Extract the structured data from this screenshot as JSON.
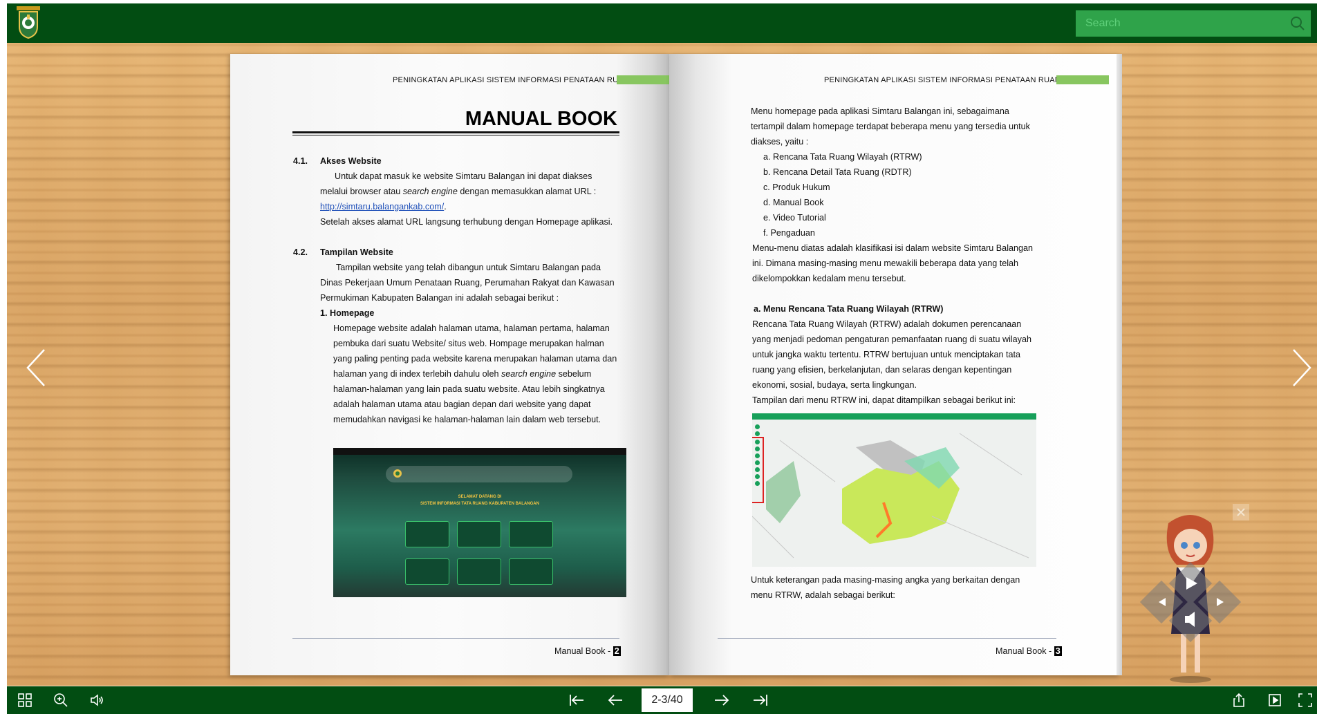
{
  "search": {
    "placeholder": "Search"
  },
  "left_page": {
    "header": "PENINGKATAN APLIKASI SISTEM INFORMASI PENATAAN RUANG",
    "title": "MANUAL BOOK",
    "section1_num": "4.1.",
    "section1_title": "Akses Website",
    "s1_line1": "Untuk dapat masuk ke website Simtaru Balangan ini dapat diakses",
    "s1_line2a": "melalui browser atau ",
    "s1_line2b": "search engine",
    "s1_line2c": " dengan memasukkan alamat URL :",
    "s1_url": "http://simtaru.balangankab.com/",
    "s1_url_tail": ".",
    "s1_line4": "Setelah akses alamat URL langsung terhubung dengan Homepage aplikasi.",
    "section2_num": "4.2.",
    "section2_title": "Tampilan Website",
    "s2_line1": "Tampilan website yang telah dibangun untuk Simtaru Balangan pada",
    "s2_line2": "Dinas Pekerjaan Umum Penataan Ruang, Perumahan Rakyat dan Kawasan",
    "s2_line3": "Permukiman Kabupaten Balangan  ini adalah sebagai berikut :",
    "sub1": "1.  Homepage",
    "hp_line1": "Homepage website adalah halaman utama, halaman pertama, halaman",
    "hp_line2": "pembuka dari suatu Website/ situs web. Hompage merupakan halman",
    "hp_line3": "yang paling penting pada website karena merupakan halaman utama dan",
    "hp_line4a": "halaman yang di index terlebih dahulu oleh ",
    "hp_line4b": "search engine",
    "hp_line4c": " sebelum",
    "hp_line5": "halaman-halaman yang lain pada suatu website. Atau lebih singkatnya",
    "hp_line6": "adalah halaman utama atau bagian depan dari website yang dapat",
    "hp_line7": "memudahkan navigasi ke halaman-halaman lain dalam web tersebut.",
    "shot_welcome1": "SELAMAT DATANG DI",
    "shot_welcome2": "SISTEM INFORMASI TATA RUANG KABUPATEN BALANGAN",
    "footer_label": "Manual Book - ",
    "footer_page": "2"
  },
  "right_page": {
    "header": "PENINGKATAN APLIKASI SISTEM INFORMASI PENATAAN RUANG",
    "intro1": "Menu homepage pada aplikasi Simtaru Balangan ini, sebagaimana",
    "intro2": "tertampil dalam homepage terdapat beberapa menu yang tersedia untuk",
    "intro3": "diakses, yaitu :",
    "menu_items": [
      "a.   Rencana Tata Ruang Wilayah (RTRW)",
      "b.   Rencana Detail Tata Ruang (RDTR)",
      "c.   Produk Hukum",
      "d.   Manual Book",
      "e.   Video Tutorial",
      "f.    Pengaduan"
    ],
    "p2_line1": "Menu-menu diatas adalah klasifikasi isi dalam website Simtaru Balangan",
    "p2_line2": "ini. Dimana masing-masing menu mewakili beberapa data yang telah",
    "p2_line3": "dikelompokkan kedalam menu tersebut.",
    "sub_a": "a.  Menu Rencana Tata Ruang Wilayah (RTRW)",
    "a_line1": "Rencana Tata Ruang Wilayah (RTRW) adalah dokumen perencanaan",
    "a_line2": "yang menjadi pedoman pengaturan pemanfaatan ruang di suatu wilayah",
    "a_line3": "untuk jangka waktu tertentu. RTRW bertujuan untuk menciptakan tata",
    "a_line4": "ruang yang efisien, berkelanjutan, dan selaras dengan kepentingan",
    "a_line5": "ekonomi, sosial, budaya, serta lingkungan.",
    "a_line6": "Tampilan dari menu RTRW ini, dapat ditampilkan sebagai berikut ini:",
    "after1": "Untuk keterangan pada masing-masing angka yang berkaitan dengan",
    "after2": "menu RTRW, adalah sebagai berikut:",
    "footer_label": "Manual Book - ",
    "footer_page": "3"
  },
  "toolbar": {
    "page_indicator": "2-3/40"
  },
  "colors": {
    "bar_green": "#024d12",
    "search_green": "#2fa34a",
    "header_accent": "#88c660"
  }
}
